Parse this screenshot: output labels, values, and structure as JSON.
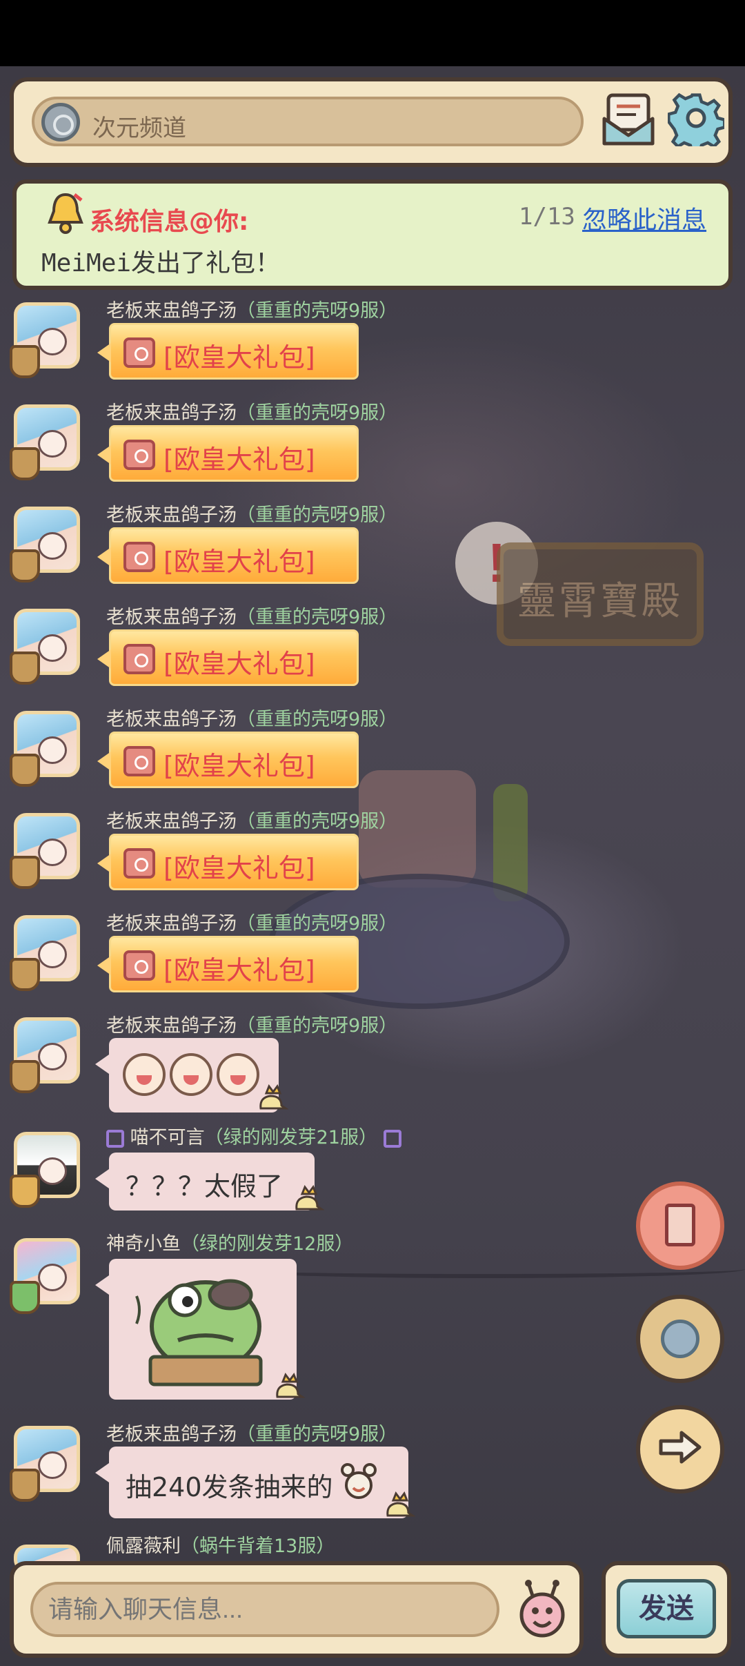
{
  "header": {
    "channel_name": "次元频道",
    "icons": [
      "channel-icon",
      "mail-icon",
      "gear-icon"
    ]
  },
  "system_notice": {
    "title": "系统信息@你:",
    "counter": "1/13",
    "ignore_link": "忽略此消息",
    "body": "MeiMei发出了礼包！"
  },
  "messages": [
    {
      "sender": "老板来盅鸽子汤",
      "server": "（重重的壳呀9服）",
      "type": "gift",
      "text": "[欧皇大礼包]"
    },
    {
      "sender": "老板来盅鸽子汤",
      "server": "（重重的壳呀9服）",
      "type": "gift",
      "text": "[欧皇大礼包]"
    },
    {
      "sender": "老板来盅鸽子汤",
      "server": "（重重的壳呀9服）",
      "type": "gift",
      "text": "[欧皇大礼包]"
    },
    {
      "sender": "老板来盅鸽子汤",
      "server": "（重重的壳呀9服）",
      "type": "gift",
      "text": "[欧皇大礼包]"
    },
    {
      "sender": "老板来盅鸽子汤",
      "server": "（重重的壳呀9服）",
      "type": "gift",
      "text": "[欧皇大礼包]"
    },
    {
      "sender": "老板来盅鸽子汤",
      "server": "（重重的壳呀9服）",
      "type": "gift",
      "text": "[欧皇大礼包]"
    },
    {
      "sender": "老板来盅鸽子汤",
      "server": "（重重的壳呀9服）",
      "type": "gift",
      "text": "[欧皇大礼包]"
    },
    {
      "sender": "老板来盅鸽子汤",
      "server": "（重重的壳呀9服）",
      "type": "emoji",
      "text": ""
    },
    {
      "sender": "喵不可言",
      "server": "（绿的刚发芽21服）",
      "type": "text",
      "text": "？？？太假了"
    },
    {
      "sender": "神奇小鱼",
      "server": "（绿的刚发芽12服）",
      "type": "sticker",
      "text": ""
    },
    {
      "sender": "老板来盅鸽子汤",
      "server": "（重重的壳呀9服）",
      "type": "text",
      "text": "抽240发条抽来的"
    },
    {
      "sender": "佩露薇利",
      "server": "（蜗牛背着13服）",
      "type": "partial",
      "text": ""
    }
  ],
  "input": {
    "placeholder": "请输入聊天信息..."
  },
  "send_button": "发送",
  "scene": {
    "sign_text": "靈霄寶殿"
  },
  "colors": {
    "panel_bg": "#f4e6c6",
    "panel_border": "#4a3b32",
    "system_bg": "#e6f2c8",
    "system_title": "#e8494f",
    "link": "#2a62c9",
    "gift_text": "#e2424a",
    "server_green": "#9fd3a0"
  }
}
